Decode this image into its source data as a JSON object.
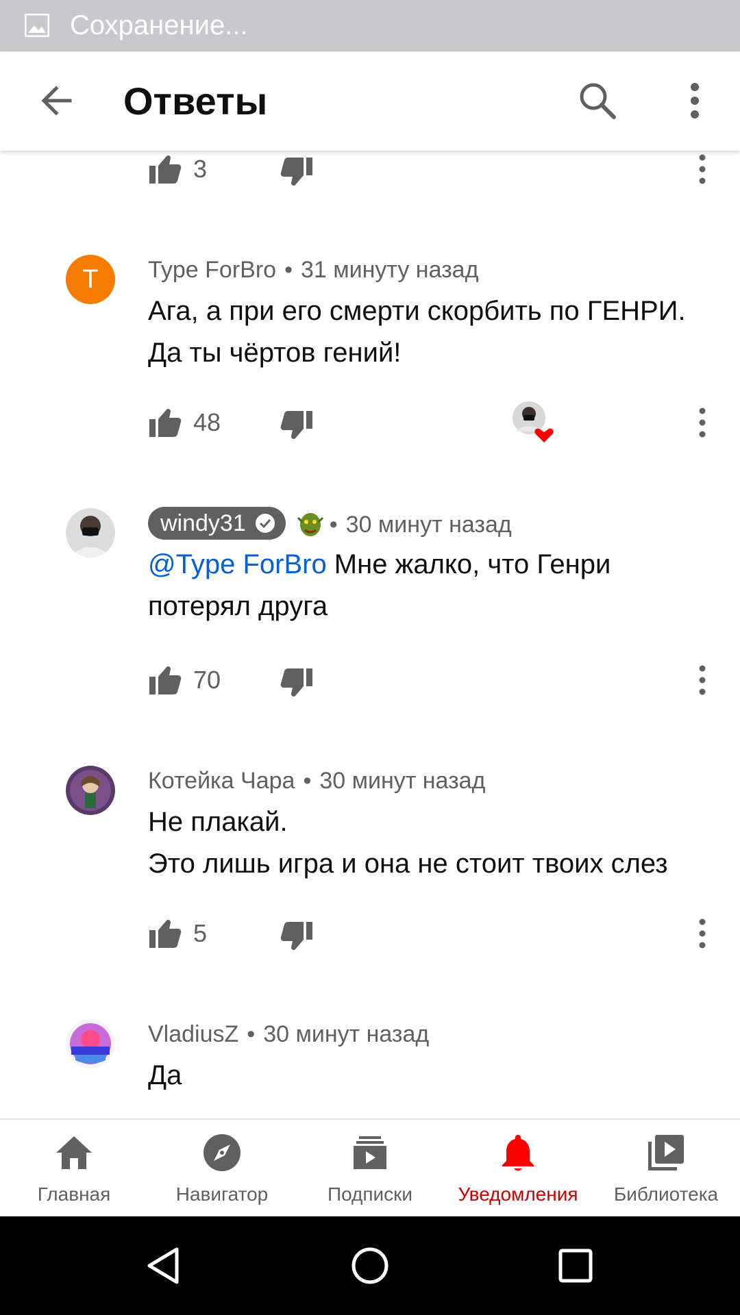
{
  "status_bar": {
    "text": "Сохранение..."
  },
  "app_bar": {
    "title": "Ответы"
  },
  "comments": [
    {
      "likes": "3"
    },
    {
      "author": "Type ForBro",
      "time": "31 минуту назад",
      "text": "Ага, а при его смерти скорбить по ГЕНРИ. Да ты чёртов гений!",
      "likes": "48",
      "avatar_letter": "T",
      "avatar_color": "#f57c00"
    },
    {
      "author": "windy31",
      "time": "30 минут назад",
      "mention": "@Type ForBro",
      "text": " Мне жалко, что Генри потерял друга",
      "likes": "70"
    },
    {
      "author": "Котейка Чара",
      "time": "30 минут назад",
      "text_line1": "Не плакай.",
      "text_line2": "Это лишь игра и она не стоит твоих слез",
      "likes": "5"
    },
    {
      "author": "VladiusZ",
      "time": "30 минут назад",
      "text": "Да"
    }
  ],
  "bottom_nav": [
    {
      "label": "Главная",
      "icon": "home-icon"
    },
    {
      "label": "Навигатор",
      "icon": "compass-icon"
    },
    {
      "label": "Подписки",
      "icon": "subscriptions-icon"
    },
    {
      "label": "Уведомления",
      "icon": "bell-icon",
      "active": true
    },
    {
      "label": "Библиотека",
      "icon": "library-icon"
    }
  ],
  "colors": {
    "accent_active": "#cc0000",
    "mention": "#065fd4",
    "secondary_text": "#606060"
  }
}
